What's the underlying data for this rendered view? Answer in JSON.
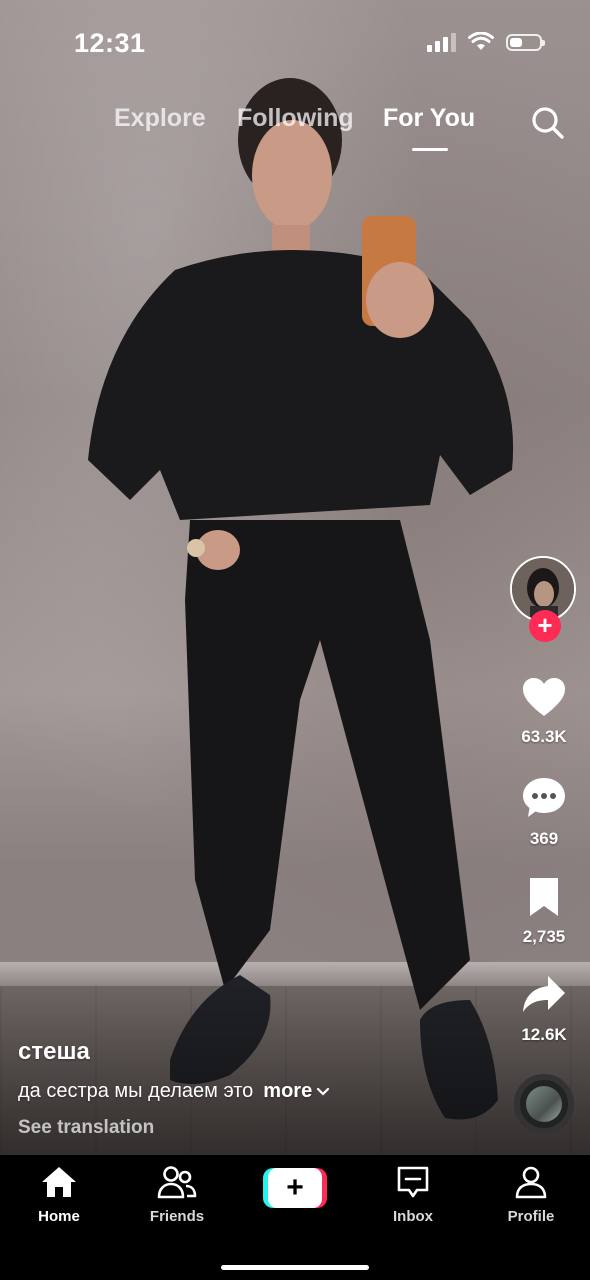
{
  "status_bar": {
    "time": "12:31",
    "battery_level": 0.42
  },
  "top_tabs": {
    "explore": "Explore",
    "following": "Following",
    "for_you": "For You",
    "active": "For You"
  },
  "rail": {
    "likes": "63.3K",
    "comments": "369",
    "saves": "2,735",
    "shares": "12.6K"
  },
  "caption": {
    "username": "стеша",
    "description": "да сестра мы делаем это",
    "more": "more",
    "see_translation": "See translation"
  },
  "bottom_nav": {
    "home": "Home",
    "friends": "Friends",
    "inbox": "Inbox",
    "profile": "Profile"
  },
  "colors": {
    "accent": "#fe2c55",
    "cyan": "#25f4ee"
  },
  "icons": [
    "search-icon",
    "heart-icon",
    "comment-icon",
    "bookmark-icon",
    "share-icon",
    "home-icon",
    "friends-icon",
    "create-icon",
    "inbox-icon",
    "profile-icon"
  ]
}
